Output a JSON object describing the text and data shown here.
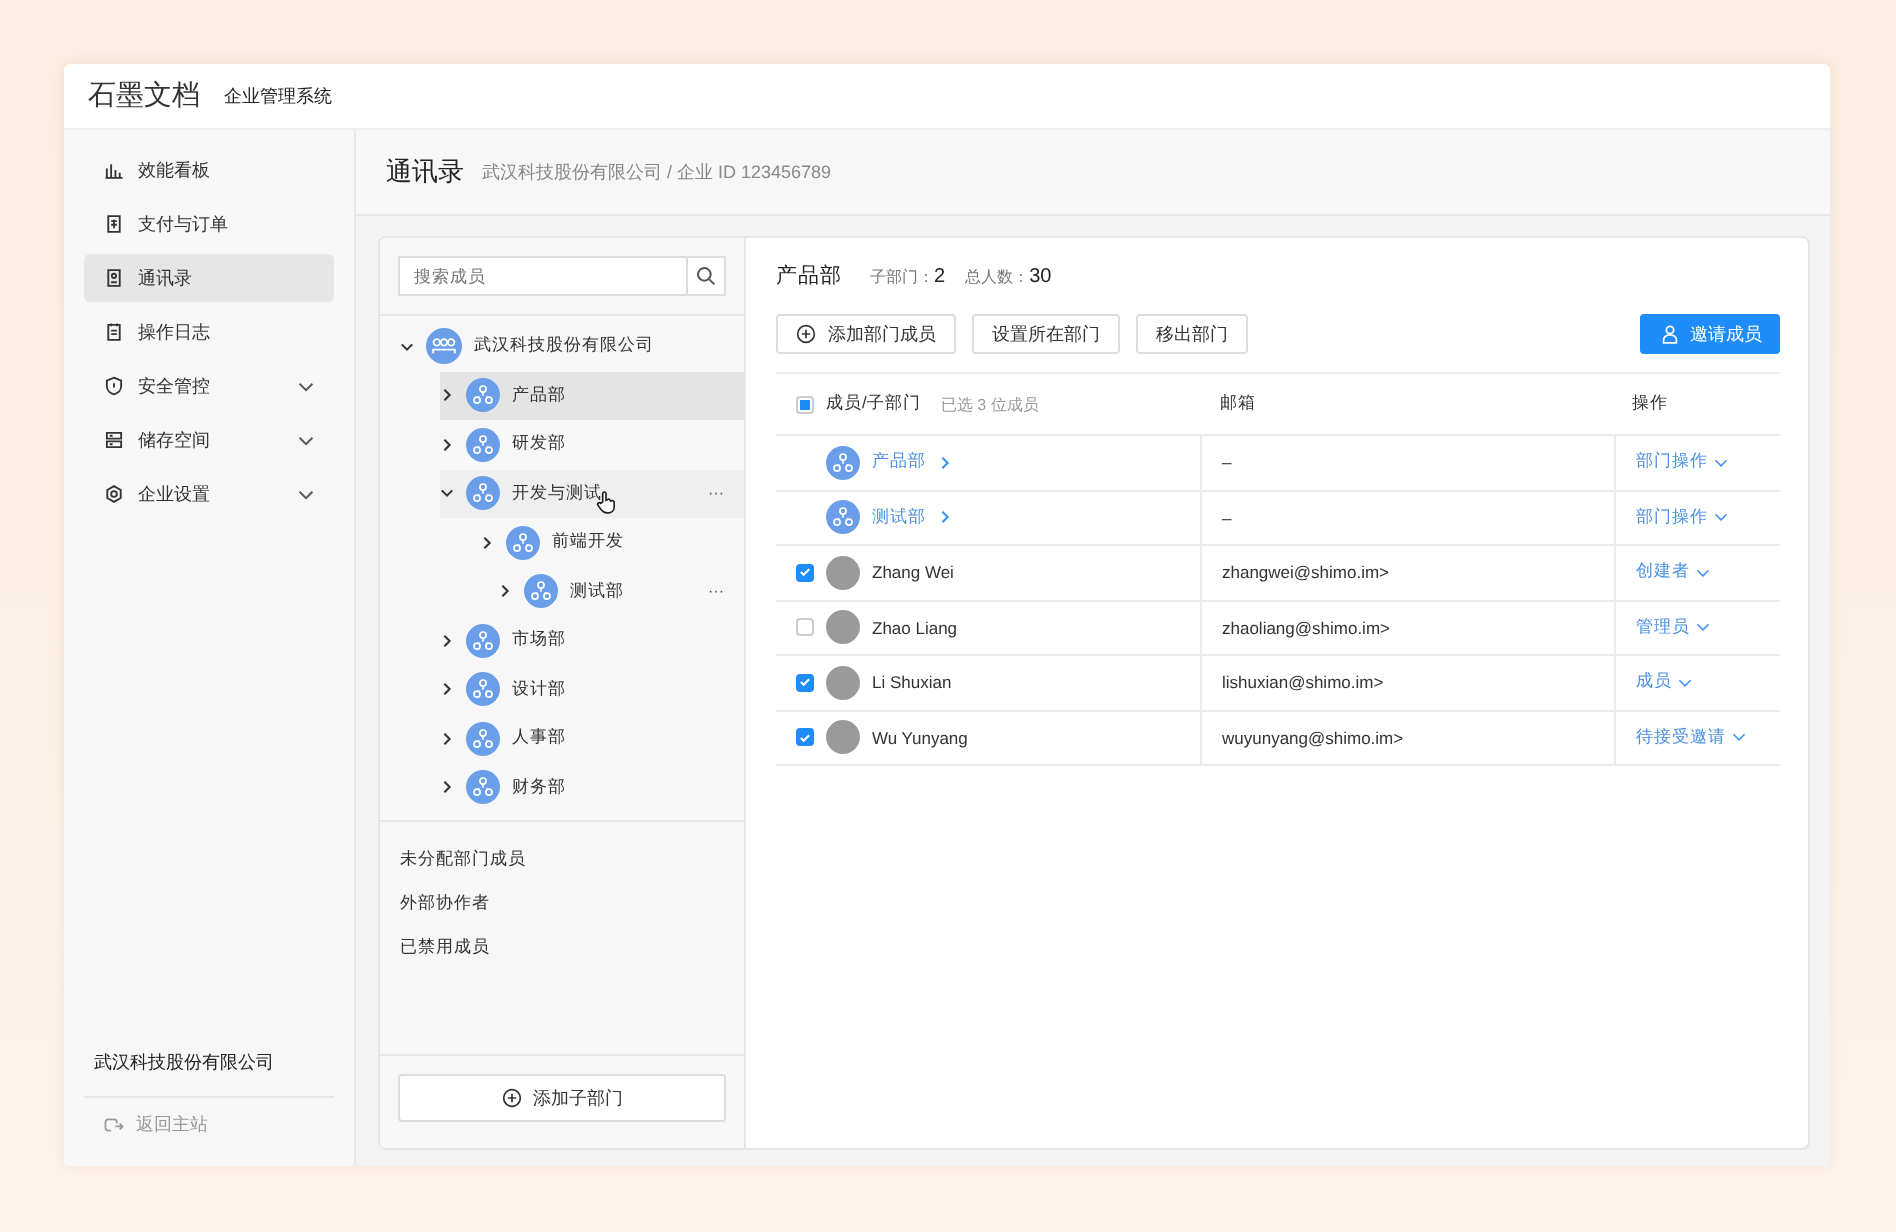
{
  "header": {
    "logo": "石墨文档",
    "subtitle": "企业管理系统"
  },
  "sidebar": {
    "items": [
      {
        "label": "效能看板",
        "selected": false,
        "has_submenu": false
      },
      {
        "label": "支付与订单",
        "selected": false,
        "has_submenu": false
      },
      {
        "label": "通讯录",
        "selected": true,
        "has_submenu": false
      },
      {
        "label": "操作日志",
        "selected": false,
        "has_submenu": false
      },
      {
        "label": "安全管控",
        "selected": false,
        "has_submenu": true
      },
      {
        "label": "储存空间",
        "selected": false,
        "has_submenu": true
      },
      {
        "label": "企业设置",
        "selected": false,
        "has_submenu": true
      }
    ],
    "company": "武汉科技股份有限公司",
    "back_link": "返回主站"
  },
  "page": {
    "title": "通讯录",
    "breadcrumb": "武汉科技股份有限公司 / 企业 ID 123456789"
  },
  "tree": {
    "search": {
      "placeholder": "搜索成员"
    },
    "nodes": [
      {
        "label": "武汉科技股份有限公司",
        "kind": "company",
        "expanded": true,
        "selected": false,
        "hovered": false,
        "children": [
          {
            "label": "产品部",
            "kind": "dept",
            "expanded": false,
            "selected": true,
            "hovered": false
          },
          {
            "label": "研发部",
            "kind": "dept",
            "expanded": false,
            "selected": false,
            "hovered": false
          },
          {
            "label": "开发与测试",
            "kind": "dept",
            "expanded": true,
            "selected": false,
            "hovered": true,
            "children": [
              {
                "label": "前端开发",
                "kind": "dept",
                "expanded": false,
                "selected": false,
                "hovered": false
              },
              {
                "label": "测试部",
                "kind": "dept",
                "expanded": false,
                "selected": false,
                "hovered": false
              }
            ]
          },
          {
            "label": "市场部",
            "kind": "dept",
            "expanded": false,
            "selected": false,
            "hovered": false
          },
          {
            "label": "设计部",
            "kind": "dept",
            "expanded": false,
            "selected": false,
            "hovered": false
          },
          {
            "label": "人事部",
            "kind": "dept",
            "expanded": false,
            "selected": false,
            "hovered": false
          },
          {
            "label": "财务部",
            "kind": "dept",
            "expanded": false,
            "selected": false,
            "hovered": false
          }
        ]
      }
    ],
    "more_marks": [
      "···",
      "···"
    ],
    "groups": [
      "未分配部门成员",
      "外部协作者",
      "已禁用成员"
    ],
    "add_button": "添加子部门"
  },
  "detail": {
    "title": "产品部",
    "stats": [
      {
        "label": "子部门：",
        "value": "2"
      },
      {
        "label": "总人数：",
        "value": "30"
      }
    ],
    "actions": [
      "添加部门成员",
      "设置所在部门",
      "移出部门"
    ],
    "invite_button": "邀请成员",
    "table": {
      "columns": [
        "成员/子部门",
        "邮箱",
        "操作"
      ],
      "selection_note": "已选 3 位成员",
      "indeterminate": true,
      "rows": [
        {
          "kind": "dept",
          "name": "产品部",
          "email": "–",
          "action": "部门操作"
        },
        {
          "kind": "dept",
          "name": "测试部",
          "email": "–",
          "action": "部门操作"
        },
        {
          "kind": "member",
          "checked": true,
          "name": "Zhang Wei",
          "email": "zhangwei@shimo.im>",
          "action": "创建者"
        },
        {
          "kind": "member",
          "checked": false,
          "name": "Zhao Liang",
          "email": "zhaoliang@shimo.im>",
          "action": "管理员"
        },
        {
          "kind": "member",
          "checked": true,
          "name": "Li Shuxian",
          "email": "lishuxian@shimo.im>",
          "action": "成员"
        },
        {
          "kind": "member",
          "checked": true,
          "name": "Wu Yunyang",
          "email": "wuyunyang@shimo.im>",
          "action": "待接受邀请"
        }
      ]
    }
  }
}
